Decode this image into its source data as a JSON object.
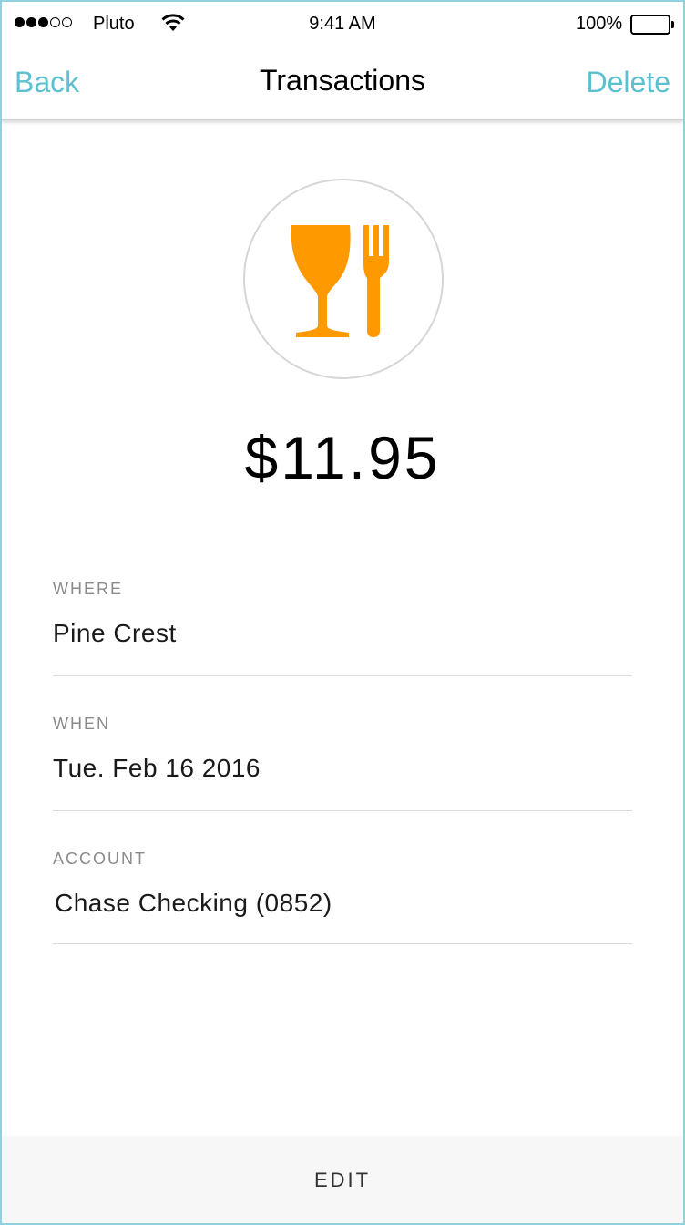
{
  "status_bar": {
    "carrier": "Pluto",
    "time": "9:41 AM",
    "battery_percent": "100%",
    "signal_bars_filled": 3,
    "signal_bars_total": 5
  },
  "nav": {
    "back_label": "Back",
    "title": "Transactions",
    "delete_label": "Delete"
  },
  "transaction": {
    "category_icon": "food-drink-icon",
    "icon_color": "#ff9900",
    "amount": "$11.95",
    "fields": [
      {
        "label": "WHERE",
        "value": "Pine Crest"
      },
      {
        "label": "WHEN",
        "value": "Tue. Feb 16 2016"
      },
      {
        "label": "ACCOUNT",
        "value": "Chase Checking (0852)"
      }
    ]
  },
  "footer": {
    "edit_label": "EDIT"
  },
  "colors": {
    "accent": "#5bc0cf",
    "icon": "#ff9900"
  }
}
